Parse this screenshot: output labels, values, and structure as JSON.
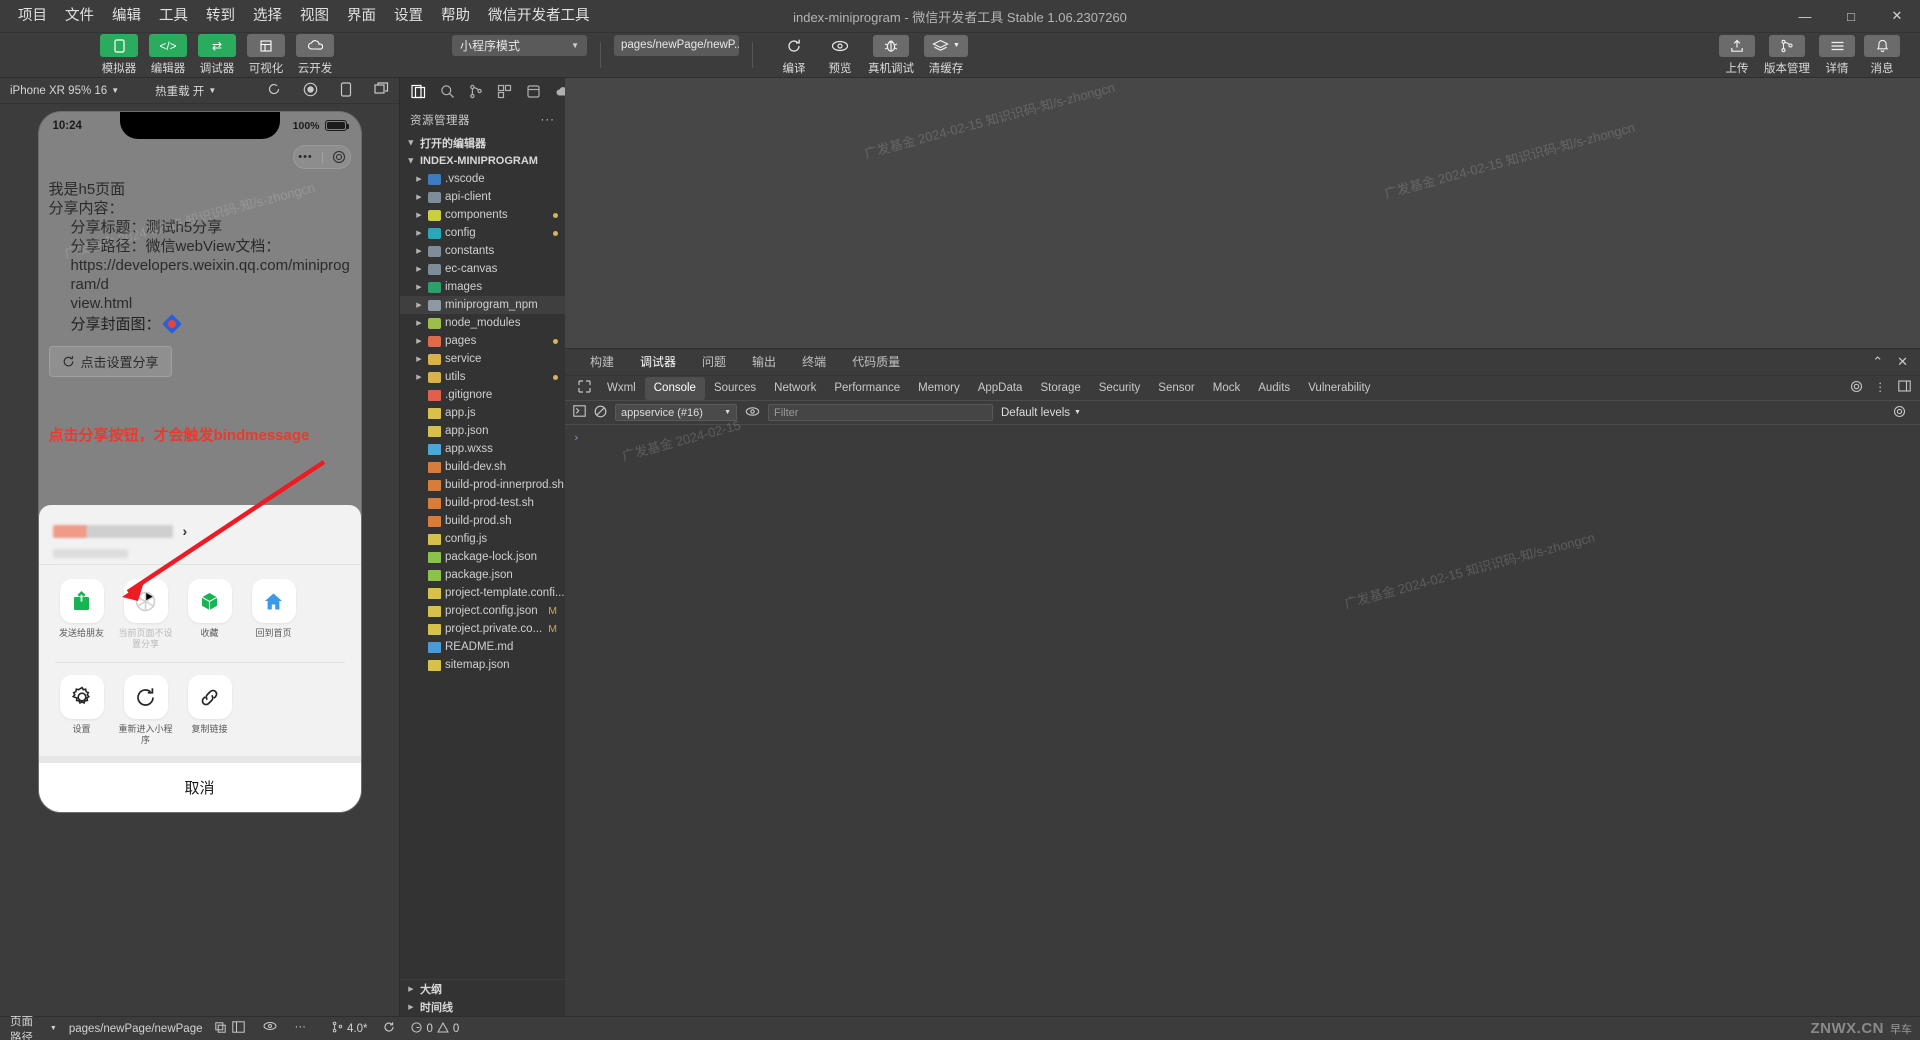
{
  "window": {
    "title": "index-miniprogram - 微信开发者工具 Stable 1.06.2307260",
    "minimize": "—",
    "maximize": "□",
    "close": "✕"
  },
  "menu": [
    "项目",
    "文件",
    "编辑",
    "工具",
    "转到",
    "选择",
    "视图",
    "界面",
    "设置",
    "帮助",
    "微信开发者工具"
  ],
  "toolbar": {
    "modes": [
      {
        "label": "模拟器",
        "icon": "phone-icon",
        "style": "green"
      },
      {
        "label": "编辑器",
        "icon": "code-icon",
        "style": "green"
      },
      {
        "label": "调试器",
        "icon": "swap-icon",
        "style": "green"
      },
      {
        "label": "可视化",
        "icon": "layout-icon",
        "style": "grey"
      },
      {
        "label": "云开发",
        "icon": "cloud-icon",
        "style": "grey"
      }
    ],
    "mode_select": "小程序模式",
    "page_select": "pages/newPage/newP...",
    "actions": [
      {
        "label": "编译",
        "icon": "refresh-icon"
      },
      {
        "label": "预览",
        "icon": "eye-icon"
      },
      {
        "label": "真机调试",
        "icon": "bug-icon"
      },
      {
        "label": "清缓存",
        "icon": "layers-icon"
      }
    ],
    "right_actions": [
      {
        "label": "上传",
        "icon": "upload-icon"
      },
      {
        "label": "版本管理",
        "icon": "branch-icon"
      },
      {
        "label": "详情",
        "icon": "menu-icon"
      },
      {
        "label": "消息",
        "icon": "bell-icon"
      }
    ]
  },
  "simulator": {
    "device": "iPhone XR 95% 16",
    "hot_reload": "热重载 开",
    "icons": [
      "refresh-icon",
      "record-icon",
      "rotate-icon",
      "multiscreen-icon"
    ],
    "phone": {
      "time": "10:24",
      "battery": "100%",
      "capsule_dots": "•••",
      "page_lines": [
        {
          "text": "我是h5页面",
          "indent": false
        },
        {
          "text": "分享内容：",
          "indent": false
        },
        {
          "text": "分享标题：测试h5分享",
          "indent": true
        },
        {
          "text": "分享路径：微信webView文档：",
          "indent": true
        },
        {
          "text": "https://developers.weixin.qq.com/miniprogram/d",
          "indent": true
        },
        {
          "text": "view.html",
          "indent": true
        }
      ],
      "cover_label": "分享封面图：",
      "share_button": "点击设置分享",
      "hint": "点击分享按钮，才会触发bindmessage"
    },
    "action_sheet": {
      "chevron": "›",
      "row1": [
        {
          "label": "发送给朋友",
          "icon": "share-box-icon",
          "dim": false
        },
        {
          "label": "当前页面不设置分享",
          "icon": "shutter-icon",
          "dim": true
        },
        {
          "label": "收藏",
          "icon": "cube-icon",
          "dim": false
        },
        {
          "label": "回到首页",
          "icon": "home-icon",
          "dim": false
        }
      ],
      "row2": [
        {
          "label": "设置",
          "icon": "gear-icon"
        },
        {
          "label": "重新进入小程序",
          "icon": "reload-icon"
        },
        {
          "label": "复制链接",
          "icon": "link-icon"
        }
      ],
      "cancel": "取消"
    }
  },
  "explorer": {
    "title": "资源管理器",
    "more": "···",
    "tabs": [
      "files-icon",
      "search-icon",
      "scm-icon",
      "extensions-icon",
      "debug-icon",
      "cloud-icon"
    ],
    "sections": [
      {
        "label": "打开的编辑器",
        "open": true
      },
      {
        "label": "INDEX-MINIPROGRAM",
        "open": true
      }
    ],
    "tree": [
      {
        "name": ".vscode",
        "type": "folder",
        "color": "#3c7cc4",
        "dot": false,
        "mod": ""
      },
      {
        "name": "api-client",
        "type": "folder",
        "color": "#7f8c99",
        "dot": false,
        "mod": ""
      },
      {
        "name": "components",
        "type": "folder",
        "color": "#c9cf3f",
        "dot": true,
        "mod": ""
      },
      {
        "name": "config",
        "type": "folder",
        "color": "#2aa7b8",
        "dot": true,
        "mod": ""
      },
      {
        "name": "constants",
        "type": "folder",
        "color": "#7f8c99",
        "dot": false,
        "mod": ""
      },
      {
        "name": "ec-canvas",
        "type": "folder",
        "color": "#7f8c99",
        "dot": false,
        "mod": ""
      },
      {
        "name": "images",
        "type": "folder",
        "color": "#2e9e6b",
        "dot": false,
        "mod": ""
      },
      {
        "name": "miniprogram_npm",
        "type": "folder",
        "color": "#8d9aa6",
        "dot": false,
        "mod": "",
        "selected": true
      },
      {
        "name": "node_modules",
        "type": "folder",
        "color": "#9bbf4a",
        "dot": false,
        "mod": ""
      },
      {
        "name": "pages",
        "type": "folder",
        "color": "#e06a4a",
        "dot": true,
        "mod": ""
      },
      {
        "name": "service",
        "type": "folder",
        "color": "#d8b24a",
        "dot": false,
        "mod": ""
      },
      {
        "name": "utils",
        "type": "folder",
        "color": "#d8b24a",
        "dot": true,
        "mod": ""
      },
      {
        "name": ".gitignore",
        "type": "file",
        "color": "#e0604a",
        "dot": false,
        "mod": ""
      },
      {
        "name": "app.js",
        "type": "file",
        "color": "#d8c14a",
        "dot": false,
        "mod": ""
      },
      {
        "name": "app.json",
        "type": "file",
        "color": "#d8c14a",
        "dot": false,
        "mod": ""
      },
      {
        "name": "app.wxss",
        "type": "file",
        "color": "#4aa8d8",
        "dot": false,
        "mod": ""
      },
      {
        "name": "build-dev.sh",
        "type": "file",
        "color": "#d87c3a",
        "dot": false,
        "mod": ""
      },
      {
        "name": "build-prod-innerprod.sh",
        "type": "file",
        "color": "#d87c3a",
        "dot": false,
        "mod": ""
      },
      {
        "name": "build-prod-test.sh",
        "type": "file",
        "color": "#d87c3a",
        "dot": false,
        "mod": ""
      },
      {
        "name": "build-prod.sh",
        "type": "file",
        "color": "#d87c3a",
        "dot": false,
        "mod": ""
      },
      {
        "name": "config.js",
        "type": "file",
        "color": "#d8c14a",
        "dot": false,
        "mod": ""
      },
      {
        "name": "package-lock.json",
        "type": "file",
        "color": "#8bc34a",
        "dot": false,
        "mod": ""
      },
      {
        "name": "package.json",
        "type": "file",
        "color": "#8bc34a",
        "dot": false,
        "mod": ""
      },
      {
        "name": "project-template.confi...",
        "type": "file",
        "color": "#d8c14a",
        "dot": false,
        "mod": ""
      },
      {
        "name": "project.config.json",
        "type": "file",
        "color": "#d8c14a",
        "dot": false,
        "mod": "M"
      },
      {
        "name": "project.private.co...",
        "type": "file",
        "color": "#d8c14a",
        "dot": false,
        "mod": "M"
      },
      {
        "name": "README.md",
        "type": "file",
        "color": "#4a9bd8",
        "dot": false,
        "mod": ""
      },
      {
        "name": "sitemap.json",
        "type": "file",
        "color": "#d8c14a",
        "dot": false,
        "mod": ""
      }
    ],
    "bottom_sections": [
      {
        "label": "大纲"
      },
      {
        "label": "时间线"
      }
    ]
  },
  "devtools": {
    "top_tabs": [
      "构建",
      "调试器",
      "问题",
      "输出",
      "终端",
      "代码质量"
    ],
    "top_active": "调试器",
    "collapse_icon": "⌃",
    "close_icon": "✕",
    "panel_tabs": [
      "Wxml",
      "Console",
      "Sources",
      "Network",
      "Performance",
      "Memory",
      "AppData",
      "Storage",
      "Security",
      "Sensor",
      "Mock",
      "Audits",
      "Vulnerability"
    ],
    "panel_active": "Console",
    "panel_right_icons": [
      "gear-icon",
      "kebab-icon",
      "dock-icon"
    ],
    "console": {
      "context": "appservice (#16)",
      "filter_placeholder": "Filter",
      "levels": "Default levels",
      "prompt": "›"
    }
  },
  "statusbar": {
    "page_path_label": "页面路径",
    "page_path": "pages/newPage/newPage",
    "copy_icon": "copy-icon",
    "sim_icons": [
      "layout-icon",
      "eye-icon",
      "more-icon"
    ],
    "version": "4.0*",
    "sync_icon": "sync-icon",
    "errors": "0",
    "warnings": "0",
    "watermark": "ZNWX.CN",
    "watermark_sub": "早车"
  },
  "watermarks": [
    "广发基金 2024-02-15 知识识码-知/s-zhongcn",
    "广发基金 2024-02-15 知识识码-知/s-zhongcn",
    "广发基金 2024-02-15 知识识码-知/s-zhongcn",
    "广发基金 2024-02-15",
    "广发基金 2024-02-15 知识识码-知/s-zhongcn"
  ]
}
